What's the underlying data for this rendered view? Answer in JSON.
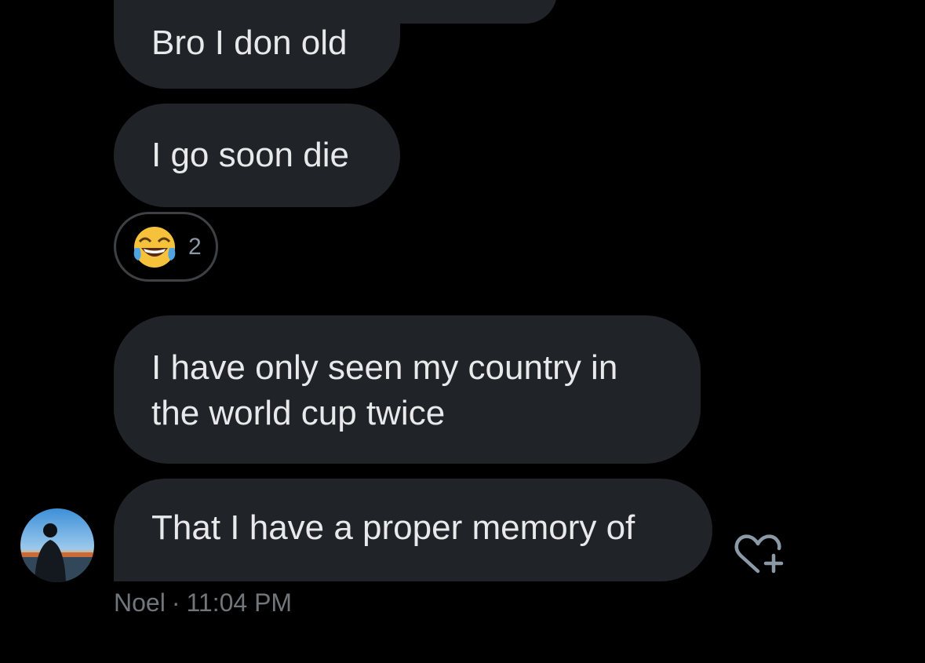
{
  "conversation": {
    "messages": [
      {
        "text": "Bro I don old"
      },
      {
        "text": "I go soon die",
        "reaction": {
          "emoji_name": "face-with-tears-of-joy",
          "count": "2"
        }
      },
      {
        "text": "I have only seen my country in\nthe world cup twice"
      },
      {
        "text": "That I have a proper memory of"
      }
    ],
    "sender": {
      "name": "Noel",
      "separator": "·",
      "timestamp": "11:04 PM"
    }
  },
  "colors": {
    "background": "#000000",
    "bubble": "#202327",
    "text": "#e7e9ea",
    "meta_text": "#71767b"
  }
}
